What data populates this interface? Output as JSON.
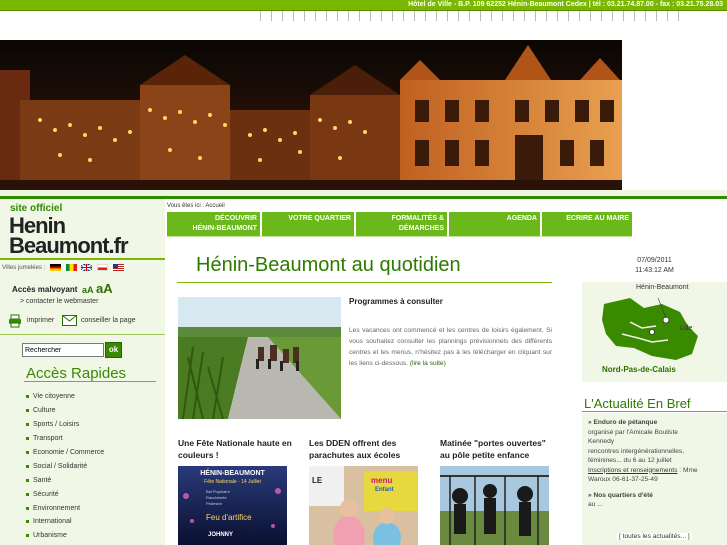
{
  "header": {
    "address": "Hôtel de Ville - B.P. 109 62252 Hénin-Beaumont Cedex | tél : 03.21.74.87.00 - fax : 03.21.75.28.03"
  },
  "branding": {
    "site_officiel": "site officiel",
    "logo_line1": "Henin",
    "logo_line2": "Beaumont.fr",
    "villes_jumelees": "Villes jumelées :",
    "flags": [
      "germany-flag-icon",
      "senegal-flag-icon",
      "uk-flag-icon",
      "poland-flag-icon",
      "usa-flag-icon"
    ]
  },
  "accessibility": {
    "label": "Accès malvoyant",
    "small": "aA",
    "big": "aA",
    "contact": "> contacter le webmaster",
    "print": "imprimer",
    "share": "conseiller la page"
  },
  "search": {
    "value": "Rechercher",
    "button": "ok"
  },
  "acces_rapides": {
    "title": "Accès Rapides",
    "items": [
      "Vie citoyenne",
      "Culture",
      "Sports / Loisirs",
      "Transport",
      "Economie / Commerce",
      "Social / Solidarité",
      "Santé",
      "Sécurité",
      "Environnement",
      "International",
      "Urbanisme"
    ]
  },
  "breadcrumb": {
    "prefix": "Vous êtes ici :",
    "current": "Accueil"
  },
  "menu": {
    "items": [
      {
        "line1": "DÉCOUVRIR",
        "line2": "HÉNIN-BEAUMONT"
      },
      {
        "line1": "VOTRE QUARTIER",
        "line2": ""
      },
      {
        "line1": "FORMALITÉS &",
        "line2": "DÉMARCHES"
      },
      {
        "line1": "AGENDA",
        "line2": ""
      },
      {
        "line1": "ECRIRE AU MAIRE",
        "line2": ""
      }
    ]
  },
  "main": {
    "title": "Hénin-Beaumont au quotidien",
    "article": {
      "title": "Programmes à consulter",
      "body": "Les vacances ont commencé et les centres de loisirs également. Si vous souhaitez consulter les plannings prévisionnels des différents centres et les menus, n'hésitez pas à les télécharger en cliquant sur les liens ci-dessous.",
      "more": "(lire la suite)"
    },
    "columns": [
      {
        "title": "Une Fête Nationale haute en couleurs !"
      },
      {
        "title": "Les DDEN offrent des parachutes aux écoles"
      },
      {
        "title": "Matinée \"portes ouvertes\" au pôle petite enfance"
      }
    ],
    "poster": {
      "title": "HÉNIN-BEAUMONT",
      "subtitle": "Fête Nationale - 14 Juillet",
      "line1": "Bal Populaire",
      "line2": "Randonnée",
      "line3": "Pédestre",
      "feu": "Feu d'artifice",
      "johnny": "JOHNNY"
    },
    "sign": {
      "text1": "LE",
      "text2": "menu",
      "text3": "Enfant"
    }
  },
  "sidebar": {
    "date": "07/09/2011",
    "time": "11:43:12 AM",
    "map": {
      "city": "Hénin-Beaumont",
      "lille": "Lille",
      "region": "Nord-Pas-de-Calais"
    },
    "actu": {
      "title": "L'Actualité En Bref",
      "item1_title": "» Enduro de pétanque",
      "item1_line1": "organisé par l'Amicale Bouliste",
      "item1_line2": "Kennedy",
      "item1_line3": "rencontres intergénérationnelles,",
      "item1_line4": "féminines... du 6 au 12 juillet",
      "item1_link": "Inscriptions et renseignements",
      "item1_line5": ": Mme",
      "item1_line6": "Waroux 06-61-37-25-49",
      "item2_title": "» Nos quartiers d'été",
      "item2_line1": "au ...",
      "all": "[ toutes les actualités... ]"
    }
  },
  "colors": {
    "brand_green": "#3a8a00",
    "menu_green": "#6ab81a",
    "top_bar": "#7ab800"
  }
}
